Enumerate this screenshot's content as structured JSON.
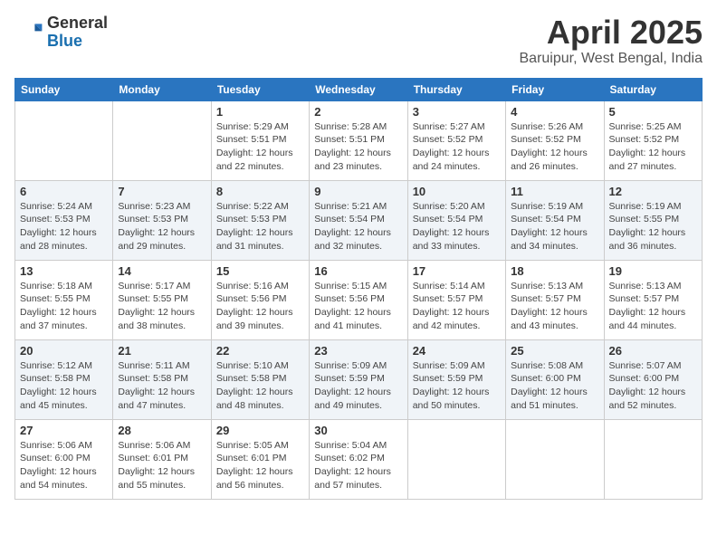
{
  "header": {
    "logo_general": "General",
    "logo_blue": "Blue",
    "month_title": "April 2025",
    "location": "Baruipur, West Bengal, India"
  },
  "weekdays": [
    "Sunday",
    "Monday",
    "Tuesday",
    "Wednesday",
    "Thursday",
    "Friday",
    "Saturday"
  ],
  "weeks": [
    [
      {
        "day": "",
        "sunrise": "",
        "sunset": "",
        "daylight": ""
      },
      {
        "day": "",
        "sunrise": "",
        "sunset": "",
        "daylight": ""
      },
      {
        "day": "1",
        "sunrise": "Sunrise: 5:29 AM",
        "sunset": "Sunset: 5:51 PM",
        "daylight": "Daylight: 12 hours and 22 minutes."
      },
      {
        "day": "2",
        "sunrise": "Sunrise: 5:28 AM",
        "sunset": "Sunset: 5:51 PM",
        "daylight": "Daylight: 12 hours and 23 minutes."
      },
      {
        "day": "3",
        "sunrise": "Sunrise: 5:27 AM",
        "sunset": "Sunset: 5:52 PM",
        "daylight": "Daylight: 12 hours and 24 minutes."
      },
      {
        "day": "4",
        "sunrise": "Sunrise: 5:26 AM",
        "sunset": "Sunset: 5:52 PM",
        "daylight": "Daylight: 12 hours and 26 minutes."
      },
      {
        "day": "5",
        "sunrise": "Sunrise: 5:25 AM",
        "sunset": "Sunset: 5:52 PM",
        "daylight": "Daylight: 12 hours and 27 minutes."
      }
    ],
    [
      {
        "day": "6",
        "sunrise": "Sunrise: 5:24 AM",
        "sunset": "Sunset: 5:53 PM",
        "daylight": "Daylight: 12 hours and 28 minutes."
      },
      {
        "day": "7",
        "sunrise": "Sunrise: 5:23 AM",
        "sunset": "Sunset: 5:53 PM",
        "daylight": "Daylight: 12 hours and 29 minutes."
      },
      {
        "day": "8",
        "sunrise": "Sunrise: 5:22 AM",
        "sunset": "Sunset: 5:53 PM",
        "daylight": "Daylight: 12 hours and 31 minutes."
      },
      {
        "day": "9",
        "sunrise": "Sunrise: 5:21 AM",
        "sunset": "Sunset: 5:54 PM",
        "daylight": "Daylight: 12 hours and 32 minutes."
      },
      {
        "day": "10",
        "sunrise": "Sunrise: 5:20 AM",
        "sunset": "Sunset: 5:54 PM",
        "daylight": "Daylight: 12 hours and 33 minutes."
      },
      {
        "day": "11",
        "sunrise": "Sunrise: 5:19 AM",
        "sunset": "Sunset: 5:54 PM",
        "daylight": "Daylight: 12 hours and 34 minutes."
      },
      {
        "day": "12",
        "sunrise": "Sunrise: 5:19 AM",
        "sunset": "Sunset: 5:55 PM",
        "daylight": "Daylight: 12 hours and 36 minutes."
      }
    ],
    [
      {
        "day": "13",
        "sunrise": "Sunrise: 5:18 AM",
        "sunset": "Sunset: 5:55 PM",
        "daylight": "Daylight: 12 hours and 37 minutes."
      },
      {
        "day": "14",
        "sunrise": "Sunrise: 5:17 AM",
        "sunset": "Sunset: 5:55 PM",
        "daylight": "Daylight: 12 hours and 38 minutes."
      },
      {
        "day": "15",
        "sunrise": "Sunrise: 5:16 AM",
        "sunset": "Sunset: 5:56 PM",
        "daylight": "Daylight: 12 hours and 39 minutes."
      },
      {
        "day": "16",
        "sunrise": "Sunrise: 5:15 AM",
        "sunset": "Sunset: 5:56 PM",
        "daylight": "Daylight: 12 hours and 41 minutes."
      },
      {
        "day": "17",
        "sunrise": "Sunrise: 5:14 AM",
        "sunset": "Sunset: 5:57 PM",
        "daylight": "Daylight: 12 hours and 42 minutes."
      },
      {
        "day": "18",
        "sunrise": "Sunrise: 5:13 AM",
        "sunset": "Sunset: 5:57 PM",
        "daylight": "Daylight: 12 hours and 43 minutes."
      },
      {
        "day": "19",
        "sunrise": "Sunrise: 5:13 AM",
        "sunset": "Sunset: 5:57 PM",
        "daylight": "Daylight: 12 hours and 44 minutes."
      }
    ],
    [
      {
        "day": "20",
        "sunrise": "Sunrise: 5:12 AM",
        "sunset": "Sunset: 5:58 PM",
        "daylight": "Daylight: 12 hours and 45 minutes."
      },
      {
        "day": "21",
        "sunrise": "Sunrise: 5:11 AM",
        "sunset": "Sunset: 5:58 PM",
        "daylight": "Daylight: 12 hours and 47 minutes."
      },
      {
        "day": "22",
        "sunrise": "Sunrise: 5:10 AM",
        "sunset": "Sunset: 5:58 PM",
        "daylight": "Daylight: 12 hours and 48 minutes."
      },
      {
        "day": "23",
        "sunrise": "Sunrise: 5:09 AM",
        "sunset": "Sunset: 5:59 PM",
        "daylight": "Daylight: 12 hours and 49 minutes."
      },
      {
        "day": "24",
        "sunrise": "Sunrise: 5:09 AM",
        "sunset": "Sunset: 5:59 PM",
        "daylight": "Daylight: 12 hours and 50 minutes."
      },
      {
        "day": "25",
        "sunrise": "Sunrise: 5:08 AM",
        "sunset": "Sunset: 6:00 PM",
        "daylight": "Daylight: 12 hours and 51 minutes."
      },
      {
        "day": "26",
        "sunrise": "Sunrise: 5:07 AM",
        "sunset": "Sunset: 6:00 PM",
        "daylight": "Daylight: 12 hours and 52 minutes."
      }
    ],
    [
      {
        "day": "27",
        "sunrise": "Sunrise: 5:06 AM",
        "sunset": "Sunset: 6:00 PM",
        "daylight": "Daylight: 12 hours and 54 minutes."
      },
      {
        "day": "28",
        "sunrise": "Sunrise: 5:06 AM",
        "sunset": "Sunset: 6:01 PM",
        "daylight": "Daylight: 12 hours and 55 minutes."
      },
      {
        "day": "29",
        "sunrise": "Sunrise: 5:05 AM",
        "sunset": "Sunset: 6:01 PM",
        "daylight": "Daylight: 12 hours and 56 minutes."
      },
      {
        "day": "30",
        "sunrise": "Sunrise: 5:04 AM",
        "sunset": "Sunset: 6:02 PM",
        "daylight": "Daylight: 12 hours and 57 minutes."
      },
      {
        "day": "",
        "sunrise": "",
        "sunset": "",
        "daylight": ""
      },
      {
        "day": "",
        "sunrise": "",
        "sunset": "",
        "daylight": ""
      },
      {
        "day": "",
        "sunrise": "",
        "sunset": "",
        "daylight": ""
      }
    ]
  ]
}
